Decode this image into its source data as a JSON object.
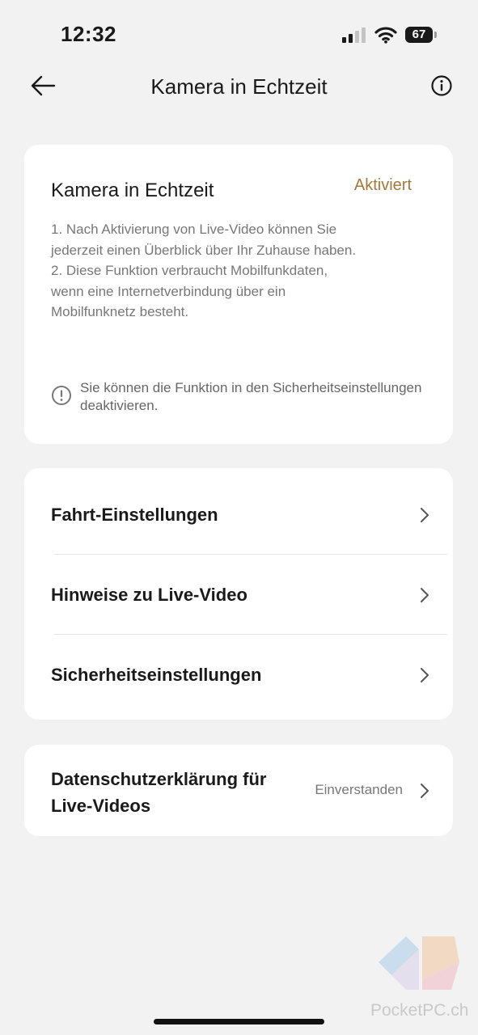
{
  "status_bar": {
    "time": "12:32",
    "battery": "67"
  },
  "nav": {
    "title": "Kamera in Echtzeit",
    "back_icon": "arrow-left-icon",
    "info_icon": "info-circle-icon"
  },
  "live_camera": {
    "title": "Kamera in Echtzeit",
    "state": "Aktiviert",
    "description": [
      "1. Nach Aktivierung von Live-Video können Sie jederzeit einen Überblick über Ihr Zuhause haben.",
      "2. Diese Funktion verbraucht Mobilfunkdaten, wenn eine Internetverbindung über ein Mobilfunknetz besteht."
    ],
    "hint": "Sie können die Funktion in den Sicherheitseinstellungen deaktivieren.",
    "accent_color": "#a8773a"
  },
  "menu": {
    "items": [
      {
        "label": "Fahrt-Einstellungen"
      },
      {
        "label": "Hinweise zu Live-Video"
      },
      {
        "label": "Sicherheitseinstellungen"
      }
    ]
  },
  "privacy": {
    "label": "Datenschutzerklärung für Live-Videos",
    "value": "Einverstanden"
  },
  "watermark": {
    "text": "PocketPC.ch"
  }
}
